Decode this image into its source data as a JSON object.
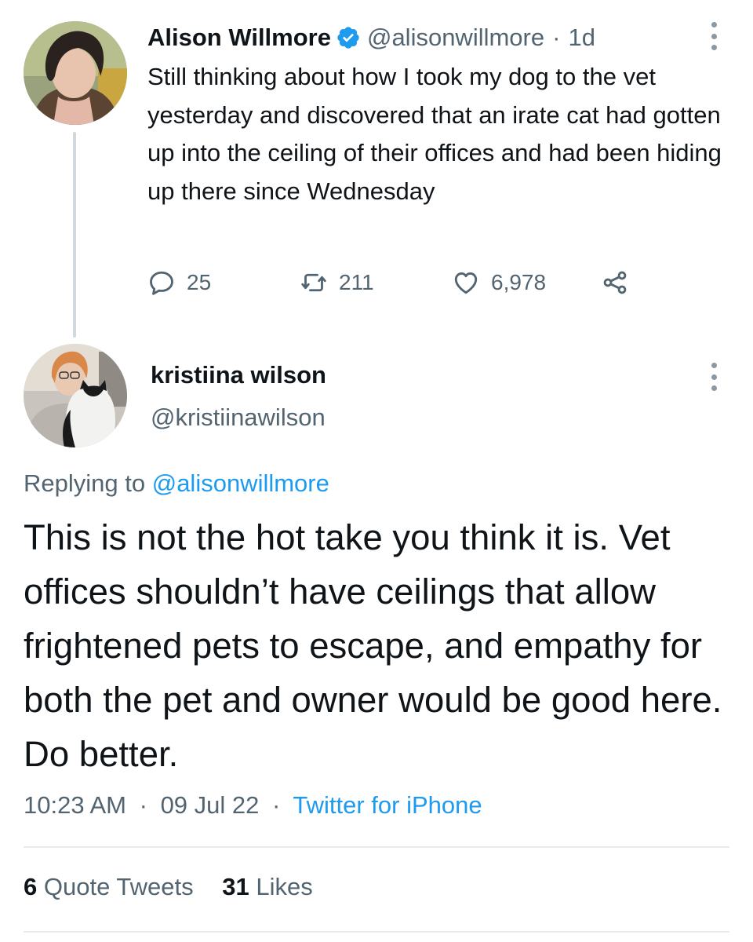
{
  "parent_tweet": {
    "author_name": "Alison Willmore",
    "verified": true,
    "handle": "@alisonwillmore",
    "separator": "·",
    "age": "1d",
    "text": "Still thinking about how I took my dog to the vet yesterday and discovered that an irate cat had gotten up into the ceiling of their offices and had been hiding up there since Wednesday",
    "counts": {
      "replies": "25",
      "retweets": "211",
      "likes": "6,978"
    },
    "icons": {
      "reply": "reply-icon",
      "retweet": "retweet-icon",
      "like": "heart-icon",
      "share": "share-icon",
      "more": "more-options-icon",
      "verified": "verified-badge-icon"
    }
  },
  "reply_tweet": {
    "author_name": "kristiina wilson",
    "handle": "@kristiinawilson",
    "replying_prefix": "Replying to",
    "replying_to": "@alisonwillmore",
    "text": "This is not the hot take you think it is. Vet offices shouldn’t have ceilings that allow frightened pets to escape, and empathy for both the pet and owner would be good here. Do better.",
    "time": "10:23 AM",
    "date": "09 Jul 22",
    "separator": "·",
    "source": "Twitter for iPhone",
    "stats": {
      "quote_count": "6",
      "quote_label": "Quote Tweets",
      "like_count": "31",
      "like_label": "Likes"
    }
  },
  "colors": {
    "text": "#0f1419",
    "secondary": "#536471",
    "accent": "#1d9bf0",
    "divider": "#e6ecf0",
    "thread_line": "#cfd9de"
  }
}
